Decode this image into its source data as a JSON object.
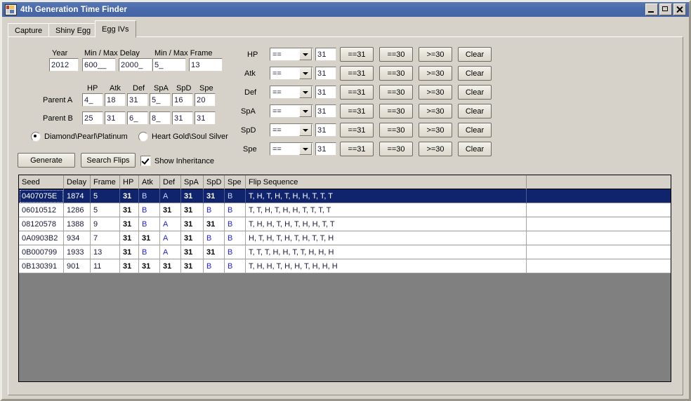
{
  "window": {
    "title": "4th Generation Time Finder",
    "icon": "app-window-icon",
    "minimize": "minimize-icon",
    "maximize": "maximize-icon",
    "close": "close-icon"
  },
  "tabs": [
    {
      "label": "Capture",
      "active": false
    },
    {
      "label": "Shiny Egg",
      "active": false
    },
    {
      "label": "Egg IVs",
      "active": true
    }
  ],
  "search_params": {
    "year_label": "Year",
    "year_value": "2012",
    "delay_label": "Min / Max Delay",
    "delay_min": "600__",
    "delay_max": "2000_",
    "frame_label": "Min / Max Frame",
    "frame_min": "5_",
    "frame_max": "13"
  },
  "stat_headers": [
    "HP",
    "Atk",
    "Def",
    "SpA",
    "SpD",
    "Spe"
  ],
  "parents": [
    {
      "label": "Parent A",
      "values": [
        "4_",
        "18",
        "31",
        "5_",
        "16",
        "20"
      ]
    },
    {
      "label": "Parent B",
      "values": [
        "25",
        "31",
        "6_",
        "8_",
        "31",
        "31"
      ]
    }
  ],
  "game_version": {
    "options": [
      {
        "label": "Diamond\\Pearl\\Platinum",
        "selected": true
      },
      {
        "label": "Heart Gold\\Soul Silver",
        "selected": false
      }
    ]
  },
  "actions": {
    "generate": "Generate",
    "search_flips": "Search Flips",
    "show_inheritance": "Show Inheritance",
    "show_inheritance_checked": true
  },
  "iv_filters": {
    "preset_labels": [
      "==31",
      "==30",
      ">=30"
    ],
    "clear_label": "Clear",
    "rows": [
      {
        "stat": "HP",
        "operator": "==",
        "value": "31"
      },
      {
        "stat": "Atk",
        "operator": "==",
        "value": "31"
      },
      {
        "stat": "Def",
        "operator": "==",
        "value": "31"
      },
      {
        "stat": "SpA",
        "operator": "==",
        "value": "31"
      },
      {
        "stat": "SpD",
        "operator": "==",
        "value": "31"
      },
      {
        "stat": "Spe",
        "operator": "==",
        "value": "31"
      }
    ]
  },
  "results": {
    "columns": [
      "Seed",
      "Delay",
      "Frame",
      "HP",
      "Atk",
      "Def",
      "SpA",
      "SpD",
      "Spe",
      "Flip Sequence"
    ],
    "rows": [
      {
        "selected": true,
        "seed": "0407075E",
        "delay": "1874",
        "frame": "5",
        "hp": "31",
        "atk": "B",
        "def": "A",
        "spa": "31",
        "spd": "31",
        "spe": "B",
        "flip": "T, H, T, H, T, H, H, T, T, T"
      },
      {
        "selected": false,
        "seed": "06010512",
        "delay": "1286",
        "frame": "5",
        "hp": "31",
        "atk": "B",
        "def": "31",
        "spa": "31",
        "spd": "B",
        "spe": "B",
        "flip": "T, T, H, T, H, H, T, T, T, T"
      },
      {
        "selected": false,
        "seed": "08120578",
        "delay": "1388",
        "frame": "9",
        "hp": "31",
        "atk": "B",
        "def": "A",
        "spa": "31",
        "spd": "31",
        "spe": "B",
        "flip": "T, H, H, T, H, T, H, H, T, T"
      },
      {
        "selected": false,
        "seed": "0A0903B2",
        "delay": "934",
        "frame": "7",
        "hp": "31",
        "atk": "31",
        "def": "A",
        "spa": "31",
        "spd": "B",
        "spe": "B",
        "flip": "H, T, H, T, H, T, H, T, T, H"
      },
      {
        "selected": false,
        "seed": "0B000799",
        "delay": "1933",
        "frame": "13",
        "hp": "31",
        "atk": "B",
        "def": "A",
        "spa": "31",
        "spd": "31",
        "spe": "B",
        "flip": "T, T, T, H, H, T, T, H, H, H"
      },
      {
        "selected": false,
        "seed": "0B130391",
        "delay": "901",
        "frame": "11",
        "hp": "31",
        "atk": "31",
        "def": "31",
        "spa": "31",
        "spd": "B",
        "spe": "B",
        "flip": "T, H, H, T, H, H, T, H, H, H"
      }
    ]
  },
  "colors": {
    "titlebar": "#4a6aaa",
    "face": "#d6d2ca",
    "selection": "#10246e",
    "inherit_marker": "#2222dd",
    "grid_empty": "#808080"
  }
}
